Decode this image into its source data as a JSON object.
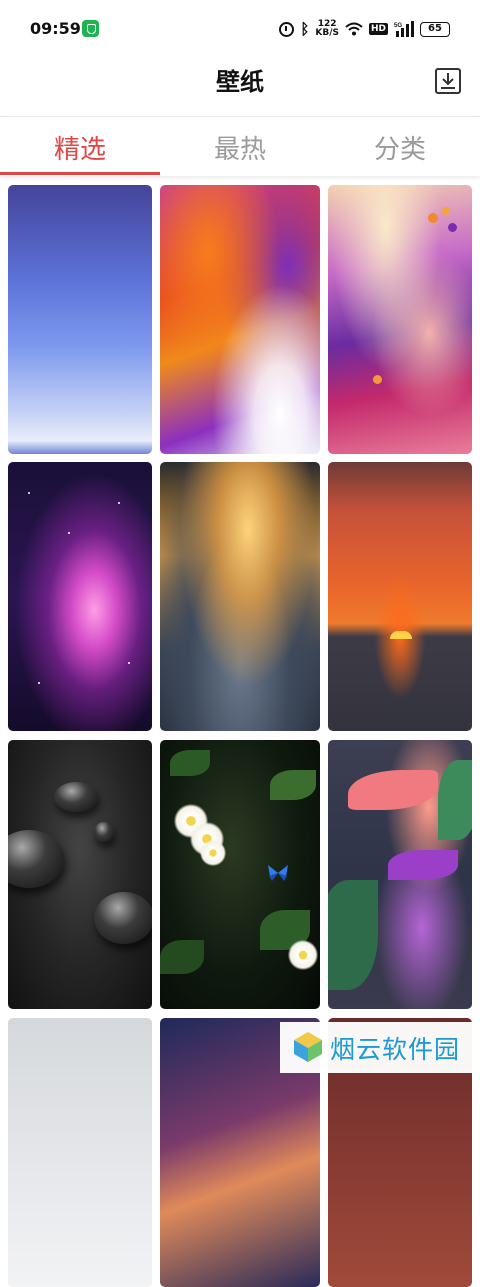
{
  "status_bar": {
    "time": "09:59",
    "net_speed_value": "122",
    "net_speed_unit": "KB/S",
    "hd_badge": "HD",
    "network_type": "5G",
    "battery_level": "65"
  },
  "header": {
    "title": "壁纸"
  },
  "tabs": [
    {
      "label": "精选",
      "active": true
    },
    {
      "label": "最热",
      "active": false
    },
    {
      "label": "分类",
      "active": false
    }
  ],
  "colors": {
    "accent": "#e04642",
    "inactive_tab": "#9a9a9a",
    "watermark": "#1a9ad6"
  },
  "wallpapers": [
    {
      "name": "blue-gradient"
    },
    {
      "name": "orange-purple-fluid"
    },
    {
      "name": "pink-marble-fluid"
    },
    {
      "name": "purple-nebula"
    },
    {
      "name": "sunset-clouds"
    },
    {
      "name": "red-sunset-sea"
    },
    {
      "name": "water-drops"
    },
    {
      "name": "jungle-flowers-butterfly"
    },
    {
      "name": "tropical-leaves"
    },
    {
      "name": "silver-abstract"
    },
    {
      "name": "swirl-abstract"
    },
    {
      "name": "dark-red"
    }
  ],
  "watermark": {
    "text": "烟云软件园"
  }
}
